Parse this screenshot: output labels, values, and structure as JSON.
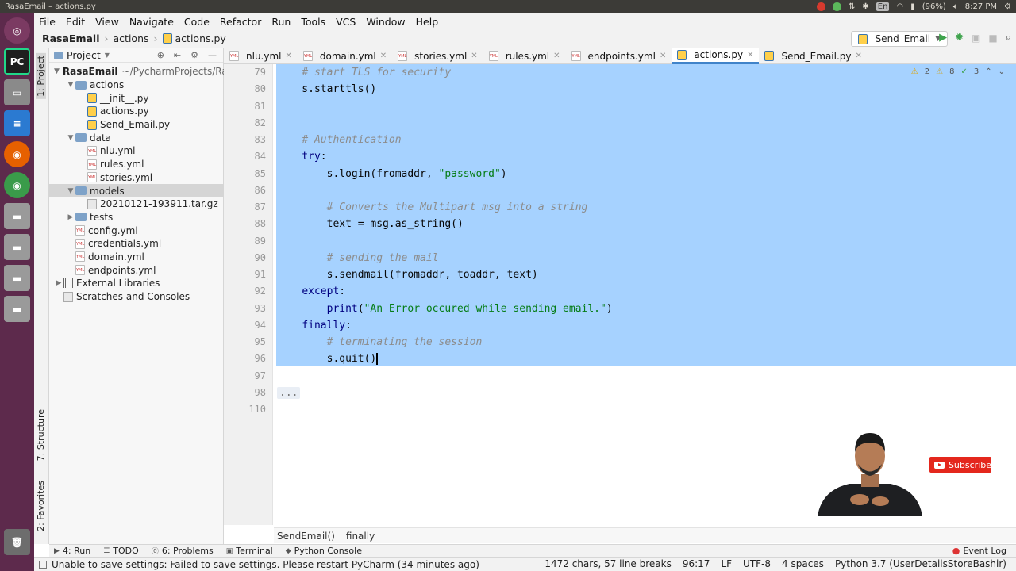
{
  "window_title": "RasaEmail – actions.py",
  "system_tray": {
    "battery": "(96%)",
    "time": "8:27 PM",
    "keyboard": "En"
  },
  "launcher_items": [
    "ubuntu-dash",
    "pycharm",
    "files",
    "libreoffice-writer",
    "firefox",
    "chrome",
    "disk-1",
    "disk-2",
    "disk-3",
    "disk-4",
    "trash"
  ],
  "menu": [
    "File",
    "Edit",
    "View",
    "Navigate",
    "Code",
    "Refactor",
    "Run",
    "Tools",
    "VCS",
    "Window",
    "Help"
  ],
  "breadcrumb": [
    "RasaEmail",
    "actions",
    "actions.py"
  ],
  "run_config": "Send_Email",
  "left_stripe": {
    "project": "1: Project",
    "structure": "7: Structure",
    "favorites": "2: Favorites"
  },
  "project_panel": {
    "title": "Project",
    "tree": [
      {
        "label": "RasaEmail",
        "extra": "~/PycharmProjects/Ra",
        "type": "folder",
        "indent": 0,
        "arrow": "▼"
      },
      {
        "label": "actions",
        "type": "folder",
        "indent": 1,
        "arrow": "▼"
      },
      {
        "label": "__init__.py",
        "type": "py",
        "indent": 2,
        "arrow": ""
      },
      {
        "label": "actions.py",
        "type": "py",
        "indent": 2,
        "arrow": ""
      },
      {
        "label": "Send_Email.py",
        "type": "py",
        "indent": 2,
        "arrow": ""
      },
      {
        "label": "data",
        "type": "folder",
        "indent": 1,
        "arrow": "▼"
      },
      {
        "label": "nlu.yml",
        "type": "yml",
        "indent": 2,
        "arrow": ""
      },
      {
        "label": "rules.yml",
        "type": "yml",
        "indent": 2,
        "arrow": ""
      },
      {
        "label": "stories.yml",
        "type": "yml",
        "indent": 2,
        "arrow": ""
      },
      {
        "label": "models",
        "type": "folder",
        "indent": 1,
        "arrow": "▼",
        "selected": true
      },
      {
        "label": "20210121-193911.tar.gz",
        "type": "gz",
        "indent": 2,
        "arrow": ""
      },
      {
        "label": "tests",
        "type": "folder",
        "indent": 1,
        "arrow": "▶"
      },
      {
        "label": "config.yml",
        "type": "yml",
        "indent": 1,
        "arrow": ""
      },
      {
        "label": "credentials.yml",
        "type": "yml",
        "indent": 1,
        "arrow": ""
      },
      {
        "label": "domain.yml",
        "type": "yml",
        "indent": 1,
        "arrow": ""
      },
      {
        "label": "endpoints.yml",
        "type": "yml",
        "indent": 1,
        "arrow": ""
      },
      {
        "label": "External Libraries",
        "type": "libs",
        "indent": 0,
        "arrow": "▶"
      },
      {
        "label": "Scratches and Consoles",
        "type": "scratch",
        "indent": 0,
        "arrow": ""
      }
    ]
  },
  "tabs": [
    {
      "label": "nlu.yml",
      "type": "yml"
    },
    {
      "label": "domain.yml",
      "type": "yml"
    },
    {
      "label": "stories.yml",
      "type": "yml"
    },
    {
      "label": "rules.yml",
      "type": "yml"
    },
    {
      "label": "endpoints.yml",
      "type": "yml"
    },
    {
      "label": "actions.py",
      "type": "py",
      "active": true
    },
    {
      "label": "Send_Email.py",
      "type": "py"
    }
  ],
  "inspections": {
    "warnings": "2",
    "weak_warnings": "8",
    "typos": "3"
  },
  "code_lines": [
    {
      "num": "79",
      "selected": true,
      "parts": [
        {
          "t": "    ",
          "c": ""
        },
        {
          "t": "# start TLS for security",
          "c": "cm"
        }
      ]
    },
    {
      "num": "80",
      "selected": true,
      "parts": [
        {
          "t": "    s.starttls()",
          "c": ""
        }
      ]
    },
    {
      "num": "81",
      "selected": true,
      "parts": []
    },
    {
      "num": "82",
      "selected": true,
      "parts": []
    },
    {
      "num": "83",
      "selected": true,
      "parts": [
        {
          "t": "    ",
          "c": ""
        },
        {
          "t": "# Authentication",
          "c": "cm"
        }
      ]
    },
    {
      "num": "84",
      "selected": true,
      "parts": [
        {
          "t": "    ",
          "c": ""
        },
        {
          "t": "try",
          "c": "kw"
        },
        {
          "t": ":",
          "c": ""
        }
      ]
    },
    {
      "num": "85",
      "selected": true,
      "parts": [
        {
          "t": "        s.login(fromaddr, ",
          "c": ""
        },
        {
          "t": "\"password\"",
          "c": "st"
        },
        {
          "t": ")",
          "c": ""
        }
      ]
    },
    {
      "num": "86",
      "selected": true,
      "parts": []
    },
    {
      "num": "87",
      "selected": true,
      "parts": [
        {
          "t": "        ",
          "c": ""
        },
        {
          "t": "# Converts the Multipart msg into a string",
          "c": "cm"
        }
      ]
    },
    {
      "num": "88",
      "selected": true,
      "parts": [
        {
          "t": "        text = msg.as_string()",
          "c": ""
        }
      ]
    },
    {
      "num": "89",
      "selected": true,
      "parts": []
    },
    {
      "num": "90",
      "selected": true,
      "parts": [
        {
          "t": "        ",
          "c": ""
        },
        {
          "t": "# sending the mail",
          "c": "cm"
        }
      ]
    },
    {
      "num": "91",
      "selected": true,
      "parts": [
        {
          "t": "        s.sendmail(fromaddr, toaddr, text)",
          "c": ""
        }
      ]
    },
    {
      "num": "92",
      "selected": true,
      "parts": [
        {
          "t": "    ",
          "c": ""
        },
        {
          "t": "except",
          "c": "kw"
        },
        {
          "t": ":",
          "c": ""
        }
      ]
    },
    {
      "num": "93",
      "selected": true,
      "parts": [
        {
          "t": "        ",
          "c": ""
        },
        {
          "t": "print",
          "c": "kw"
        },
        {
          "t": "(",
          "c": ""
        },
        {
          "t": "\"An Error occured while sending email.\"",
          "c": "st"
        },
        {
          "t": ")",
          "c": ""
        }
      ]
    },
    {
      "num": "94",
      "selected": true,
      "parts": [
        {
          "t": "    ",
          "c": ""
        },
        {
          "t": "finally",
          "c": "kw"
        },
        {
          "t": ":",
          "c": ""
        }
      ]
    },
    {
      "num": "95",
      "selected": true,
      "parts": [
        {
          "t": "        ",
          "c": ""
        },
        {
          "t": "# terminating the session",
          "c": "cm"
        }
      ]
    },
    {
      "num": "96",
      "selected": true,
      "caret": true,
      "parts": [
        {
          "t": "        s.quit()",
          "c": ""
        }
      ]
    },
    {
      "num": "97",
      "selected": false,
      "parts": []
    },
    {
      "num": "98",
      "selected": false,
      "fold": true,
      "parts": [
        {
          "t": "...",
          "c": "fold"
        }
      ]
    },
    {
      "num": "110",
      "selected": false,
      "parts": []
    }
  ],
  "code_breadcrumb": [
    "SendEmail()",
    "finally"
  ],
  "tool_windows": [
    {
      "label": "4: Run",
      "icon": "run-icon"
    },
    {
      "label": "TODO",
      "icon": "todo-icon"
    },
    {
      "label": "6: Problems",
      "icon": "problems-icon"
    },
    {
      "label": "Terminal",
      "icon": "terminal-icon"
    },
    {
      "label": "Python Console",
      "icon": "python-icon"
    }
  ],
  "event_log": "Event Log",
  "status": {
    "message": "Unable to save settings: Failed to save settings. Please restart PyCharm (34 minutes ago)",
    "chars": "1472 chars, 57 line breaks",
    "position": "96:17",
    "line_sep": "LF",
    "encoding": "UTF-8",
    "indent": "4 spaces",
    "interpreter": "Python 3.7 (UserDetailsStoreBashir)"
  },
  "subscribe_label": "Subscribe",
  "colors": {
    "selection": "#a6d2ff",
    "keyword": "#000080",
    "comment": "#8c8c8c",
    "string": "#067d17",
    "launcher": "#5d2a4c",
    "subscribe": "#e4271d"
  }
}
